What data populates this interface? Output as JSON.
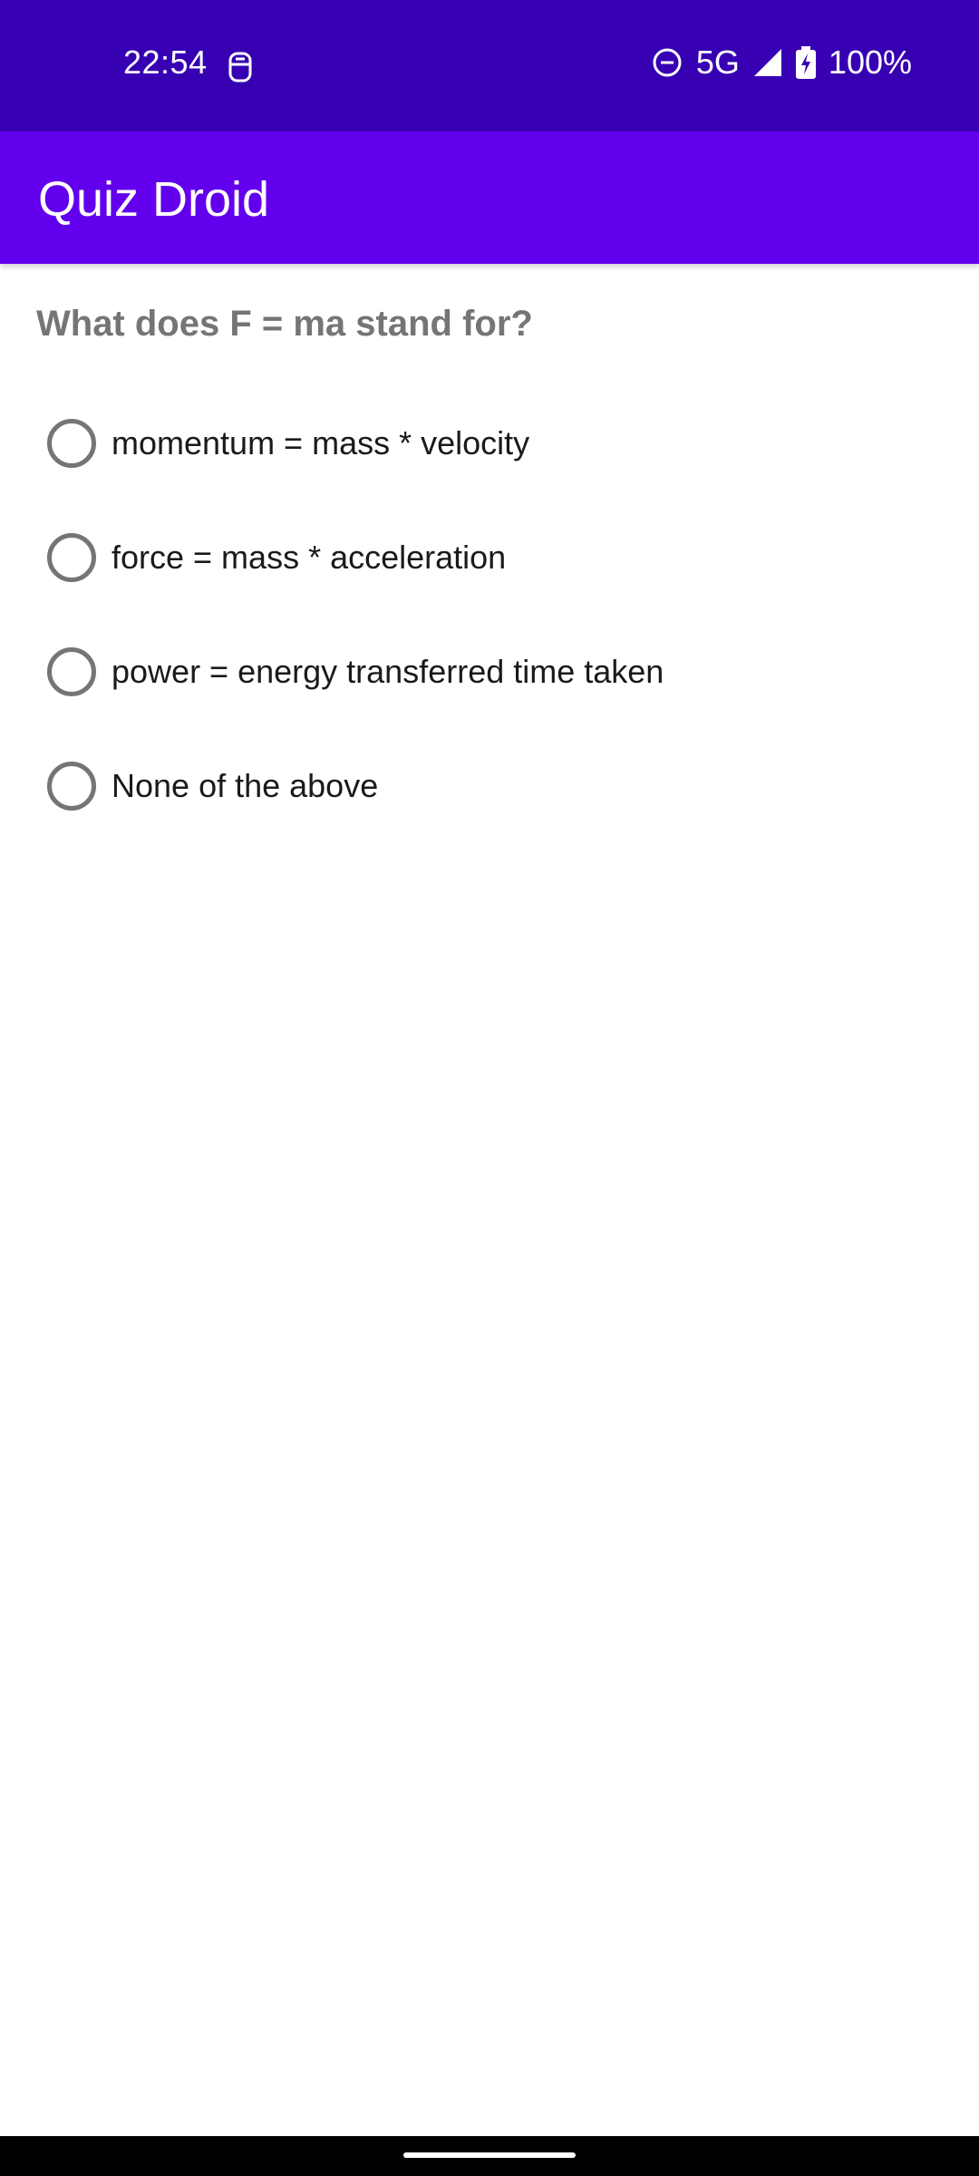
{
  "status_bar": {
    "time": "22:54",
    "network": "5G",
    "battery": "100%",
    "icons": [
      "screenshot-icon",
      "do-not-disturb-icon",
      "signal-icon",
      "battery-charging-icon"
    ]
  },
  "app_bar": {
    "title": "Quiz Droid",
    "color": "#6200EE",
    "status_color": "#3700B3"
  },
  "quiz": {
    "question": "What does F = ma stand for?",
    "options": [
      {
        "label": "momentum = mass * velocity",
        "selected": false
      },
      {
        "label": "force = mass * acceleration",
        "selected": false
      },
      {
        "label": "power = energy transferred time taken",
        "selected": false
      },
      {
        "label": "None of the above",
        "selected": false
      }
    ]
  }
}
